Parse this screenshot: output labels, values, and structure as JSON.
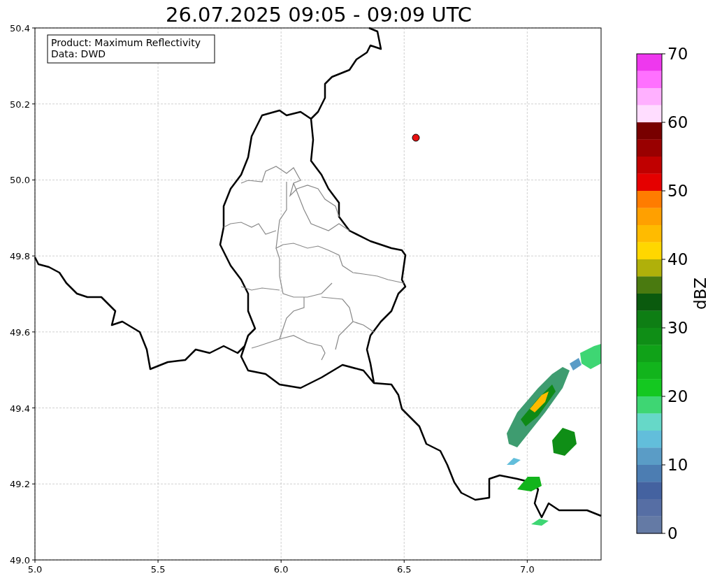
{
  "title": "26.07.2025 09:05 - 09:09 UTC",
  "info_box": {
    "lines": [
      "Product: Maximum Reflectivity",
      "Data: DWD"
    ]
  },
  "map": {
    "x_ticks": [
      "5.0",
      "5.5",
      "6.0",
      "6.5",
      "7.0"
    ],
    "y_ticks": [
      "50.4",
      "50.2",
      "50.0",
      "49.8",
      "49.6",
      "49.4",
      "49.2",
      "49.0"
    ]
  },
  "colorbar": {
    "label": "dBZ",
    "ticks": [
      "70",
      "60",
      "50",
      "40",
      "30",
      "20",
      "10",
      "0"
    ],
    "bands": [
      {
        "color": "#ee38ee"
      },
      {
        "color": "#ff70ff"
      },
      {
        "color": "#ffb0ff"
      },
      {
        "color": "#ffddff"
      },
      {
        "color": "#780000"
      },
      {
        "color": "#990000"
      },
      {
        "color": "#c00000"
      },
      {
        "color": "#e50000"
      },
      {
        "color": "#ff7c00"
      },
      {
        "color": "#ffa000"
      },
      {
        "color": "#ffbb00"
      },
      {
        "color": "#ffd700"
      },
      {
        "color": "#b0b00a"
      },
      {
        "color": "#4a7a10"
      },
      {
        "color": "#0a5a0e"
      },
      {
        "color": "#0e7e14"
      },
      {
        "color": "#0f8e16"
      },
      {
        "color": "#10a218"
      },
      {
        "color": "#12b41c"
      },
      {
        "color": "#14c820"
      },
      {
        "color": "#3ed673"
      },
      {
        "color": "#66d8c8"
      },
      {
        "color": "#62bedb"
      },
      {
        "color": "#5a9cc6"
      },
      {
        "color": "#4c7db2"
      },
      {
        "color": "#4462a0"
      },
      {
        "color": "#566ea4"
      },
      {
        "color": "#647aa5"
      }
    ]
  }
}
